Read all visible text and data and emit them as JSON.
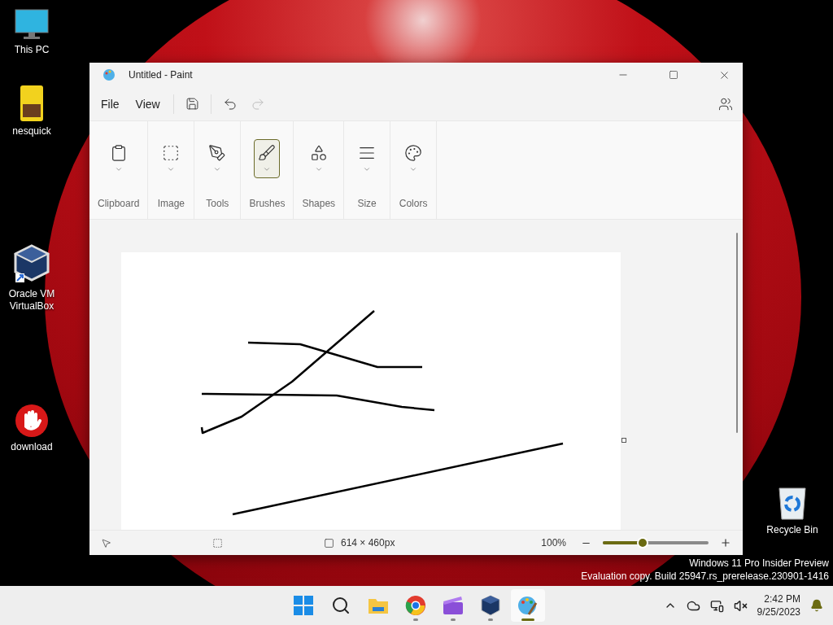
{
  "desktop_icons": [
    {
      "kind": "pc",
      "label": "This PC"
    },
    {
      "kind": "file",
      "label": "nesquick"
    },
    {
      "kind": "vbox",
      "label": "Oracle VM VirtualBox"
    },
    {
      "kind": "stop",
      "label": "download"
    },
    {
      "kind": "bin",
      "label": "Recycle Bin"
    }
  ],
  "window": {
    "title": "Untitled - Paint"
  },
  "menu": [
    "File",
    "View"
  ],
  "ribbon": [
    {
      "kind": "clipboard",
      "label": "Clipboard",
      "selected": false
    },
    {
      "kind": "image",
      "label": "Image",
      "selected": false
    },
    {
      "kind": "tools",
      "label": "Tools",
      "selected": false
    },
    {
      "kind": "brushes",
      "label": "Brushes",
      "selected": true
    },
    {
      "kind": "shapes",
      "label": "Shapes",
      "selected": false
    },
    {
      "kind": "size",
      "label": "Size",
      "selected": false
    },
    {
      "kind": "colors",
      "label": "Colors",
      "selected": false
    }
  ],
  "status_bar": {
    "canvas_size": "614 × 460px",
    "zoom": "100%",
    "zoom_level": {
      "level": 0.38
    }
  },
  "watermark_os": [
    "Windows 11 Pro Insider Preview",
    "Evaluation copy. Build 25947.rs_prerelease.230901-1416"
  ],
  "taskbar": {
    "apps": [
      {
        "kind": "start",
        "running": false,
        "active": false
      },
      {
        "kind": "search",
        "running": false,
        "active": false
      },
      {
        "kind": "explorer",
        "running": false,
        "active": false
      },
      {
        "kind": "browser",
        "running": true,
        "active": false
      },
      {
        "kind": "clapper",
        "running": true,
        "active": false
      },
      {
        "kind": "vbox",
        "running": true,
        "active": false
      },
      {
        "kind": "paint",
        "running": true,
        "active": true
      }
    ],
    "time": "2:42 PM",
    "date": "9/25/2023"
  }
}
